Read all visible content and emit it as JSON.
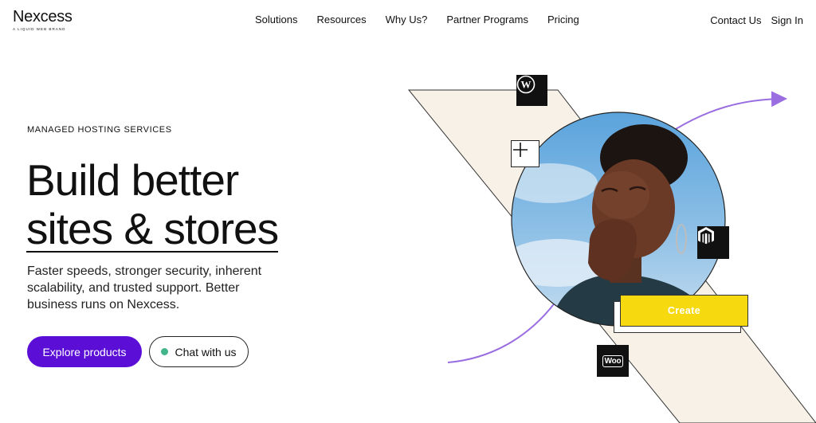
{
  "brand": {
    "name": "Nexcess",
    "tagline": "A LIQUID WEB BRAND"
  },
  "nav": {
    "items": [
      "Solutions",
      "Resources",
      "Why Us?",
      "Partner Programs",
      "Pricing"
    ],
    "contact": "Contact Us",
    "signin": "Sign In"
  },
  "hero": {
    "eyebrow": "MANAGED HOSTING SERVICES",
    "headline_line1": "Build better",
    "headline_line2": "sites & stores",
    "subtext": "Faster speeds, stronger security, inherent scalability, and trusted support. Better business runs on Nexcess.",
    "primary_cta": "Explore products",
    "secondary_cta": "Chat with us"
  },
  "art": {
    "create_label": "Create",
    "woo_label": "Woo",
    "icons": [
      "wordpress-icon",
      "plus-icon",
      "magento-icon",
      "woocommerce-icon"
    ]
  },
  "colors": {
    "accent": "#5b0fd6",
    "chat_dot": "#43b58a",
    "create_yellow": "#f6d90f",
    "band_beige": "#f7f1e7",
    "arrow_purple": "#9a6ee0"
  }
}
